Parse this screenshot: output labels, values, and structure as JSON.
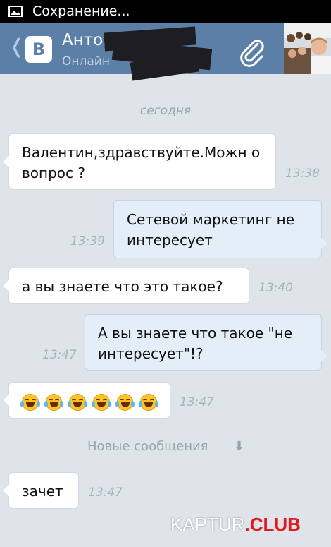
{
  "status_bar": {
    "text": "Сохранение..."
  },
  "header": {
    "back_glyph": "❬",
    "logo_letter": "В",
    "contact_name": "Антон",
    "contact_status": "Онлайн",
    "icons": [
      "back-icon",
      "vk-logo-icon",
      "attach-icon",
      "avatar"
    ]
  },
  "chat": {
    "date_separator": "сегодня",
    "messages": [
      {
        "direction": "in",
        "text": "Валентин,здравствуйте.Можн о вопрос ?",
        "time": "13:38"
      },
      {
        "direction": "out",
        "text": "Сетевой маркетинг не интересует",
        "time": "13:39"
      },
      {
        "direction": "in",
        "text": "а вы знаете что это такое?",
        "time": "13:40"
      },
      {
        "direction": "out",
        "text": "А вы знаете что такое \"не интересует\"!?",
        "time": "13:47"
      },
      {
        "direction": "in",
        "text": "",
        "emoji_count": 6,
        "emoji": "face-with-tears-of-joy",
        "time": "13:47"
      },
      {
        "direction": "in",
        "text": "зачет",
        "time": "13:47"
      }
    ],
    "new_messages_label": "Новые сообщения",
    "new_messages_arrow": "⬇"
  },
  "watermark": {
    "part1": "KAPTUR",
    "part2": ".CLUB"
  },
  "colors": {
    "header": "#5b7fa6",
    "chat_bg": "#dfe4ea",
    "out_bubble": "#e3eef9",
    "in_bubble": "#ffffff"
  }
}
